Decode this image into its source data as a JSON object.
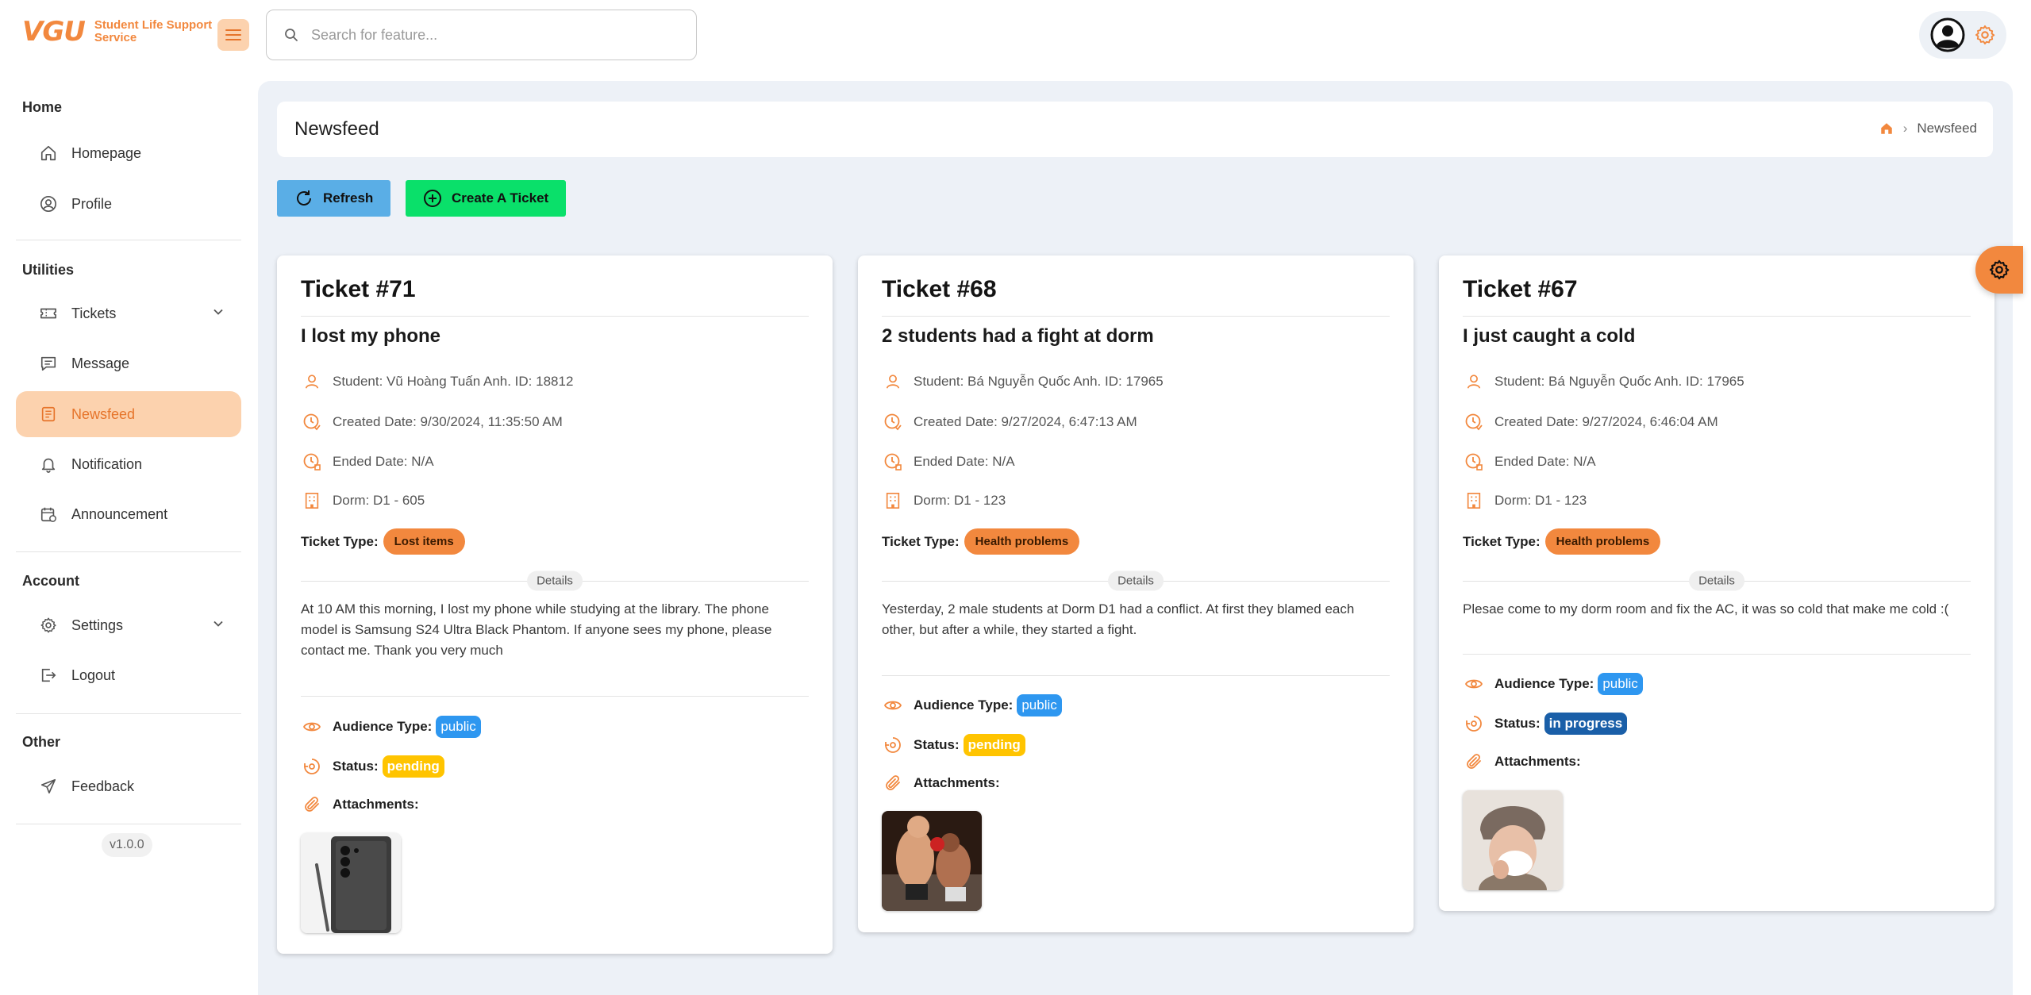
{
  "app": {
    "logo_mark": "VGU",
    "logo_text_line1": "Student Life Support",
    "logo_text_line2": "Service"
  },
  "search": {
    "placeholder": "Search for feature..."
  },
  "sidebar": {
    "sections": [
      {
        "title": "Home"
      },
      {
        "title": "Utilities"
      },
      {
        "title": "Account"
      },
      {
        "title": "Other"
      }
    ],
    "items": [
      {
        "label": "Homepage",
        "icon": "home-icon"
      },
      {
        "label": "Profile",
        "icon": "user-circle-icon"
      },
      {
        "label": "Tickets",
        "icon": "ticket-icon"
      },
      {
        "label": "Message",
        "icon": "message-icon"
      },
      {
        "label": "Newsfeed",
        "icon": "newsfeed-icon",
        "active": true
      },
      {
        "label": "Notification",
        "icon": "bell-icon"
      },
      {
        "label": "Announcement",
        "icon": "calendar-icon"
      },
      {
        "label": "Settings",
        "icon": "gear-icon"
      },
      {
        "label": "Logout",
        "icon": "logout-icon"
      },
      {
        "label": "Feedback",
        "icon": "send-icon"
      }
    ],
    "version": "v1.0.0"
  },
  "header": {
    "title": "Newsfeed",
    "breadcrumb_current": "Newsfeed"
  },
  "actions": {
    "refresh": "Refresh",
    "create": "Create A Ticket"
  },
  "labels": {
    "ticket_type": "Ticket Type:",
    "details": "Details",
    "audience_type": "Audience Type:",
    "status": "Status:",
    "attachments": "Attachments:"
  },
  "colors": {
    "accent": "#f2883e",
    "public": "#2e97f0",
    "pending": "#ffc400",
    "in_progress": "#1a5fa8",
    "refresh": "#5aaee6",
    "create": "#0ae06a"
  },
  "tickets": [
    {
      "number": "Ticket #71",
      "title": "I lost my phone",
      "student": "Student: Vũ Hoàng Tuấn Anh. ID: 18812",
      "created": "Created Date: 9/30/2024, 11:35:50 AM",
      "ended": "Ended Date: N/A",
      "dorm": "Dorm: D1 - 605",
      "type": "Lost items",
      "description": "At 10 AM this morning, I lost my phone while studying at the library. The phone model is Samsung S24 Ultra Black Phantom. If anyone sees my phone, please contact me. Thank you very much",
      "audience": "public",
      "status": "pending"
    },
    {
      "number": "Ticket #68",
      "title": "2 students had a fight at dorm",
      "student": "Student: Bá Nguyễn Quốc Anh. ID: 17965",
      "created": "Created Date: 9/27/2024, 6:47:13 AM",
      "ended": "Ended Date: N/A",
      "dorm": "Dorm: D1 - 123",
      "type": "Health problems",
      "description": "Yesterday, 2 male students at Dorm D1 had a conflict. At first they blamed each other, but after a while, they started a fight.",
      "audience": "public",
      "status": "pending"
    },
    {
      "number": "Ticket #67",
      "title": "I just caught a cold",
      "student": "Student: Bá Nguyễn Quốc Anh. ID: 17965",
      "created": "Created Date: 9/27/2024, 6:46:04 AM",
      "ended": "Ended Date: N/A",
      "dorm": "Dorm: D1 - 123",
      "type": "Health problems",
      "description": "Plesae come to my dorm room and fix the AC, it was so cold that make me cold :(",
      "audience": "public",
      "status": "in progress"
    }
  ]
}
